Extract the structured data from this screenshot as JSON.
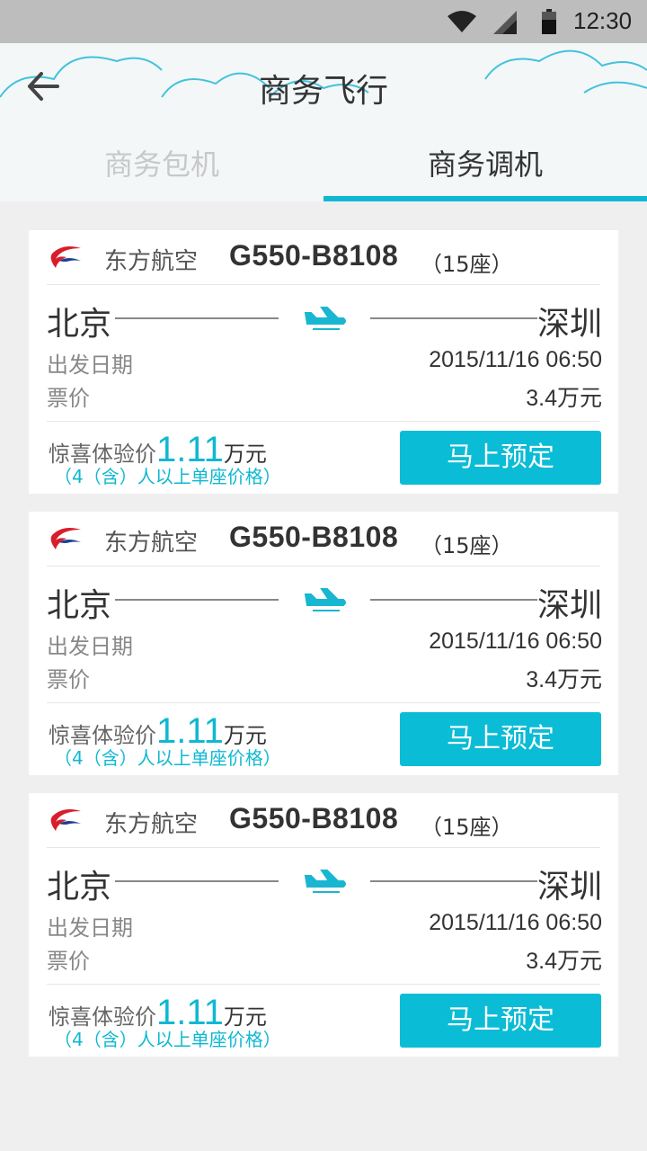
{
  "status_bar": {
    "time": "12:30"
  },
  "header": {
    "title": "商务飞行",
    "tabs": [
      {
        "label": "商务包机",
        "active": false
      },
      {
        "label": "商务调机",
        "active": true
      }
    ],
    "accent_color": "#0fb8d2"
  },
  "flights": [
    {
      "airline": "东方航空",
      "flight_no": "G550-B8108",
      "seats": "（15座）",
      "from": "北京",
      "to": "深圳",
      "date_label": "出发日期",
      "date_value": "2015/11/16  06:50",
      "price_label": "票价",
      "price_value": "3.4",
      "price_unit": "万元",
      "promo_prefix": "惊喜体验价",
      "promo_amount": "1.11",
      "promo_unit": "万元",
      "promo_note": "（4（含）人以上单座价格）",
      "button": "马上预定"
    },
    {
      "airline": "东方航空",
      "flight_no": "G550-B8108",
      "seats": "（15座）",
      "from": "北京",
      "to": "深圳",
      "date_label": "出发日期",
      "date_value": "2015/11/16  06:50",
      "price_label": "票价",
      "price_value": "3.4",
      "price_unit": "万元",
      "promo_prefix": "惊喜体验价",
      "promo_amount": "1.11",
      "promo_unit": "万元",
      "promo_note": "（4（含）人以上单座价格）",
      "button": "马上预定"
    },
    {
      "airline": "东方航空",
      "flight_no": "G550-B8108",
      "seats": "（15座）",
      "from": "北京",
      "to": "深圳",
      "date_label": "出发日期",
      "date_value": "2015/11/16  06:50",
      "price_label": "票价",
      "price_value": "3.4",
      "price_unit": "万元",
      "promo_prefix": "惊喜体验价",
      "promo_amount": "1.11",
      "promo_unit": "万元",
      "promo_note": "（4（含）人以上单座价格）",
      "button": "马上预定"
    }
  ]
}
